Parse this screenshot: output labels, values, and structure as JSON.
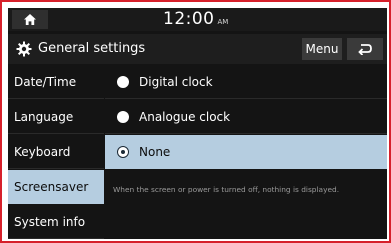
{
  "statusbar": {
    "home_icon": "home-icon",
    "time": "12:00",
    "ampm": "AM"
  },
  "header": {
    "title": "General settings",
    "title_icon": "gear-icon",
    "menu_label": "Menu",
    "back_icon": "back-arrow-icon"
  },
  "sidebar": {
    "items": [
      {
        "label": "Date/Time",
        "active": false
      },
      {
        "label": "Language",
        "active": false
      },
      {
        "label": "Keyboard",
        "active": false
      },
      {
        "label": "Screensaver",
        "active": true
      },
      {
        "label": "System info",
        "active": false
      }
    ]
  },
  "screensaver": {
    "options": [
      {
        "label": "Digital clock",
        "selected": false
      },
      {
        "label": "Analogue clock",
        "selected": false
      },
      {
        "label": "None",
        "selected": true
      }
    ],
    "description": "When the screen or power is turned off, nothing is displayed."
  },
  "colors": {
    "frame_border": "#d6202b",
    "background": "#141414",
    "highlight": "#b5cde0",
    "button": "#3a3a3a"
  }
}
